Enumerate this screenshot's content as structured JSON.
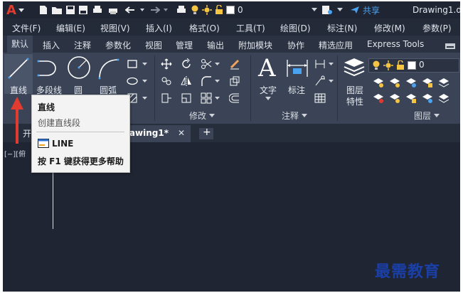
{
  "titlebar": {
    "app_letter": "A",
    "layer_value": "0",
    "share_label": "共享",
    "doc_title": "Drawing1.dv"
  },
  "menu": [
    "文件(F)",
    "编辑(E)",
    "视图(V)",
    "插入(I)",
    "格式(O)",
    "工具(T)",
    "绘图(D)",
    "标注(N)",
    "修改(M)",
    "参数(P)"
  ],
  "ribbon_tabs": [
    "默认",
    "插入",
    "注释",
    "参数化",
    "视图",
    "管理",
    "输出",
    "附加模块",
    "协作",
    "精选应用",
    "Express Tools"
  ],
  "ribbon": {
    "draw_tools": [
      "直线",
      "多段线",
      "圆",
      "圆弧"
    ],
    "modify_panel": "修改",
    "annotation_tools": [
      "文字",
      "标注"
    ],
    "annotation_panel": "注释",
    "layer_props": [
      "图层",
      "特性"
    ],
    "layer_panel": "图层",
    "layer_value": "0"
  },
  "doc_tabs": {
    "partial_start": "开",
    "active": "rawing1*",
    "close": "✕",
    "add": "+"
  },
  "canvas": {
    "viewport_label": "[−][俯"
  },
  "tooltip": {
    "title": "直线",
    "description": "创建直线段",
    "command": "LINE",
    "help": "按 F1 键获得更多帮助"
  },
  "watermark": "最需教育",
  "colors": {
    "background": "#1f2533",
    "ribbon": "#3a4456",
    "accent_red": "#e23b2f",
    "watermark": "#1a40a8"
  }
}
